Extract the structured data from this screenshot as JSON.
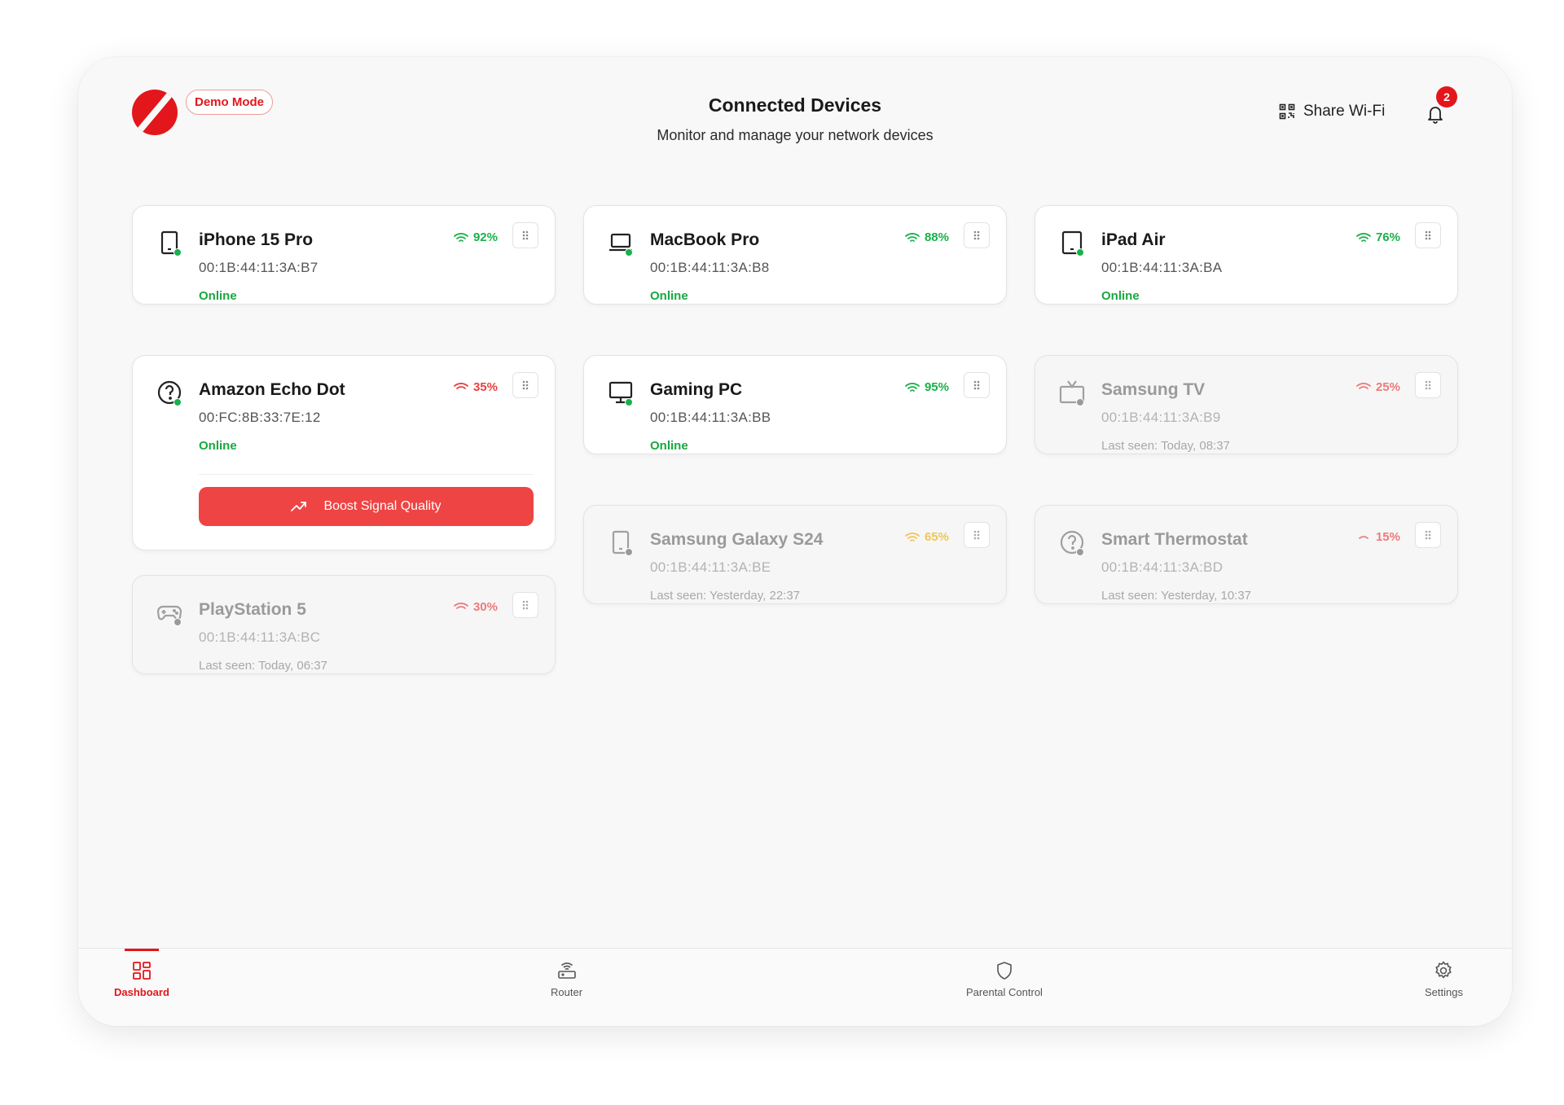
{
  "header": {
    "demo_badge": "Demo Mode",
    "title": "Connected Devices",
    "subtitle": "Monitor and manage your network devices",
    "share_wifi": "Share Wi-Fi",
    "notification_count": "2"
  },
  "colors": {
    "brand": "#e3161b",
    "online": "#18a940",
    "signal_good": "#18b14a",
    "signal_medium": "#f0c020",
    "signal_weak": "#e84040",
    "boost_button": "#ef4444"
  },
  "devices": [
    {
      "name": "iPhone 15 Pro",
      "mac": "00:1B:44:11:3A:B7",
      "status": "Online",
      "signal": "92%",
      "icon": "phone-icon",
      "online": true
    },
    {
      "name": "MacBook Pro",
      "mac": "00:1B:44:11:3A:B8",
      "status": "Online",
      "signal": "88%",
      "icon": "laptop-icon",
      "online": true
    },
    {
      "name": "iPad Air",
      "mac": "00:1B:44:11:3A:BA",
      "status": "Online",
      "signal": "76%",
      "icon": "tablet-icon",
      "online": true
    },
    {
      "name": "Amazon Echo Dot",
      "mac": "00:FC:8B:33:7E:12",
      "status": "Online",
      "signal": "35%",
      "icon": "unknown-device-icon",
      "online": true,
      "action": "Boost Signal Quality"
    },
    {
      "name": "Gaming PC",
      "mac": "00:1B:44:11:3A:BB",
      "status": "Online",
      "signal": "95%",
      "icon": "monitor-icon",
      "online": true
    },
    {
      "name": "Samsung TV",
      "mac": "00:1B:44:11:3A:B9",
      "status": "Last seen: Today, 08:37",
      "signal": "25%",
      "icon": "tv-icon",
      "online": false
    },
    {
      "name": "Samsung Galaxy S24",
      "mac": "00:1B:44:11:3A:BE",
      "status": "Last seen: Yesterday, 22:37",
      "signal": "65%",
      "icon": "phone-icon",
      "online": false
    },
    {
      "name": "Smart Thermostat",
      "mac": "00:1B:44:11:3A:BD",
      "status": "Last seen: Yesterday, 10:37",
      "signal": "15%",
      "icon": "unknown-device-icon",
      "online": false
    },
    {
      "name": "PlayStation 5",
      "mac": "00:1B:44:11:3A:BC",
      "status": "Last seen: Today, 06:37",
      "signal": "30%",
      "icon": "gamepad-icon",
      "online": false
    }
  ],
  "nav": [
    {
      "label": "Dashboard",
      "icon": "dashboard-icon",
      "active": true
    },
    {
      "label": "Router",
      "icon": "router-icon",
      "active": false
    },
    {
      "label": "Parental Control",
      "icon": "shield-icon",
      "active": false
    },
    {
      "label": "Settings",
      "icon": "gear-icon",
      "active": false
    }
  ]
}
